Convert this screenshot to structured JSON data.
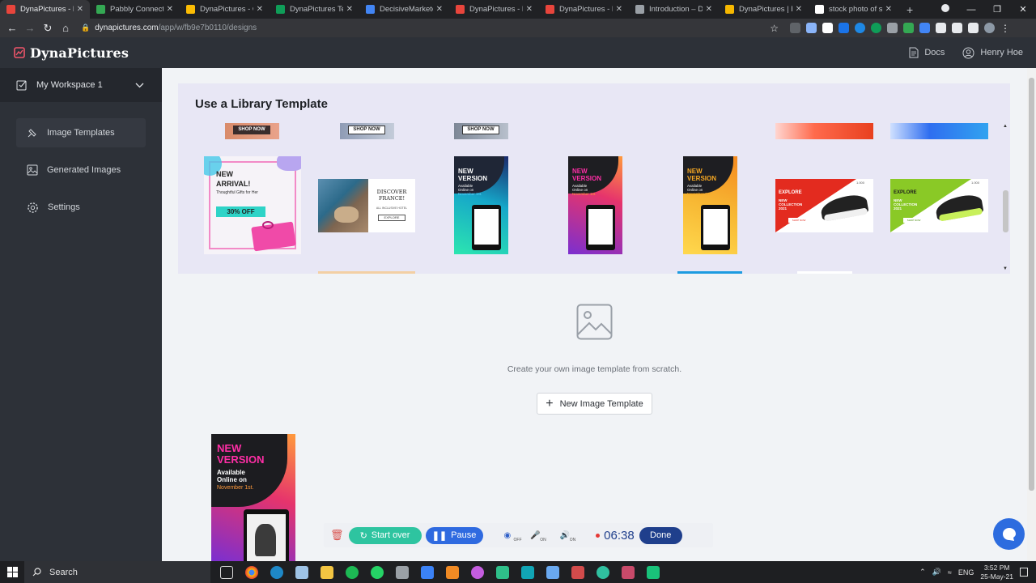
{
  "browser": {
    "tabs": [
      {
        "title": "DynaPictures - De",
        "color": "#e8453c",
        "active": true
      },
      {
        "title": "Pabbly Connect",
        "color": "#34a853",
        "active": false
      },
      {
        "title": "DynaPictures - Go",
        "color": "#fbbc04",
        "active": false
      },
      {
        "title": "DynaPictures Test",
        "color": "#0f9d58",
        "active": false
      },
      {
        "title": "DecisiveMarketer",
        "color": "#4285f4",
        "active": false
      },
      {
        "title": "DynaPictures - De",
        "color": "#e8453c",
        "active": false
      },
      {
        "title": "DynaPictures - De",
        "color": "#e8453c",
        "active": false
      },
      {
        "title": "Introduction – Doc",
        "color": "#9aa0a6",
        "active": false
      },
      {
        "title": "DynaPictures | Exc",
        "color": "#f6b800",
        "active": false
      },
      {
        "title": "stock photo of sta",
        "color": "#ffffff",
        "active": false
      }
    ],
    "url_host": "dynapictures.com",
    "url_path": "/app/w/fb9e7b0110/designs"
  },
  "app": {
    "brand": "DynaPictures",
    "docs_label": "Docs",
    "user_name": "Henry Hoe"
  },
  "sidebar": {
    "workspace": "My Workspace 1",
    "items": [
      {
        "label": "Image Templates",
        "selected": true
      },
      {
        "label": "Generated Images",
        "selected": false
      },
      {
        "label": "Settings",
        "selected": false
      }
    ]
  },
  "library": {
    "title": "Use a Library Template",
    "shop_now": "SHOP NOW",
    "arrival": {
      "line1": "NEW",
      "line2": "ARRIVAL!",
      "sub": "Thoughtful Gifts for Her",
      "badge": "30% OFF"
    },
    "france": {
      "line1": "DISCOVER",
      "line2": "FRANCE!",
      "sub": "ALL INCLUSIVE HOTEL",
      "btn": "EXPLORE"
    },
    "version": {
      "line1": "NEW",
      "line2": "VERSION",
      "sub1": "Available",
      "sub2": "Online on",
      "date": "November 1st."
    },
    "sneaker": {
      "line1": "EXPLORE",
      "line2": "NEW",
      "line3": "COLLECTION",
      "year": "2021",
      "btn": "SHOP NOW",
      "price": "1.000"
    }
  },
  "main": {
    "create_text": "Create your own image template from scratch.",
    "new_button": "New Image Template",
    "card": {
      "line1": "NEW",
      "line2": "VERSION",
      "sub1": "Available",
      "sub2": "Online on",
      "date": "November 1st."
    }
  },
  "recorder": {
    "start_over": "Start over",
    "pause": "Pause",
    "done": "Done",
    "timer": "06:38",
    "off1": "OFF",
    "on1": "ON",
    "on2": "ON"
  },
  "taskbar": {
    "search": "Search",
    "lang": "ENG",
    "time": "3:52 PM",
    "date": "25-May-21"
  }
}
